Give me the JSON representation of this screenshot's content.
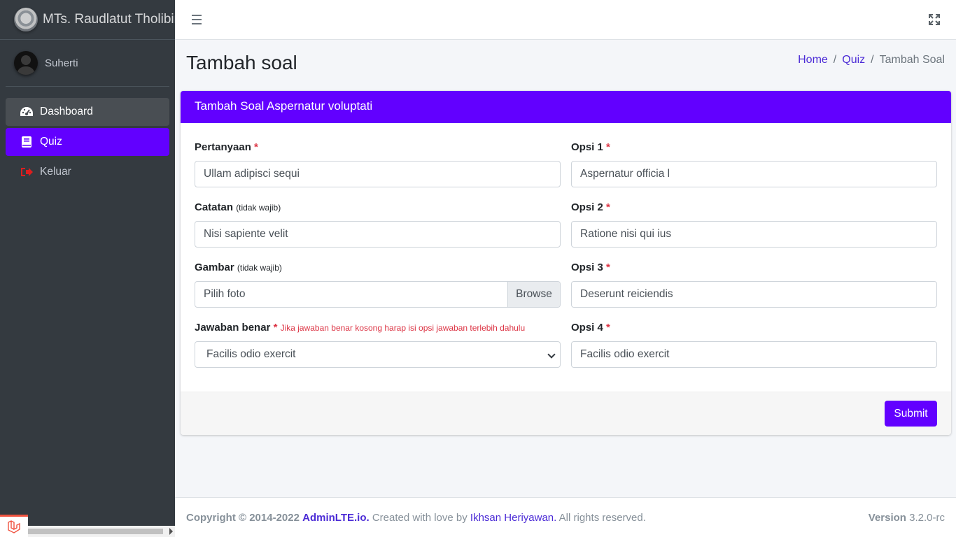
{
  "brand": {
    "name": "MTs. Raudlatut Tholibin",
    "logo_icon": "school-logo-icon"
  },
  "user": {
    "name": "Suherti"
  },
  "sidebar": {
    "items": [
      {
        "label": "Dashboard",
        "icon": "tachometer-icon"
      },
      {
        "label": "Quiz",
        "icon": "book-icon",
        "active": true
      },
      {
        "label": "Keluar",
        "icon": "sign-out-icon"
      }
    ]
  },
  "page": {
    "title": "Tambah soal",
    "breadcrumb": {
      "home": "Home",
      "sep": "/",
      "quiz": "Quiz",
      "current": "Tambah Soal"
    }
  },
  "form": {
    "header": "Tambah Soal Aspernatur voluptati",
    "required_mark": "*",
    "pertanyaan": {
      "label": "Pertanyaan",
      "value": "Ullam adipisci sequi"
    },
    "catatan": {
      "label": "Catatan",
      "note": "(tidak wajib)",
      "value": "Nisi sapiente velit"
    },
    "gambar": {
      "label": "Gambar",
      "note": "(tidak wajib)",
      "placeholder": "Pilih foto",
      "browse": "Browse"
    },
    "jawaban": {
      "label": "Jawaban benar",
      "hint": "Jika jawaban benar kosong harap isi opsi jawaban terlebih dahulu",
      "selected": "Facilis odio exercit"
    },
    "opsi1": {
      "label": "Opsi 1",
      "value": "Aspernatur officia l"
    },
    "opsi2": {
      "label": "Opsi 2",
      "value": "Ratione nisi qui ius"
    },
    "opsi3": {
      "label": "Opsi 3",
      "value": "Deserunt reiciendis"
    },
    "opsi4": {
      "label": "Opsi 4",
      "value": "Facilis odio exercit"
    },
    "submit": "Submit"
  },
  "footer": {
    "copyright": "Copyright © 2014-2022",
    "brand_link": "AdminLTE.io.",
    "created": "Created with love by",
    "author": "Ikhsan Heriyawan.",
    "rights": "All rights reserved.",
    "version_label": "Version",
    "version": "3.2.0-rc"
  },
  "colors": {
    "accent": "#6200ff",
    "sidebar": "#343a40",
    "required": "#dc3545",
    "link": "#4b2bd6"
  }
}
